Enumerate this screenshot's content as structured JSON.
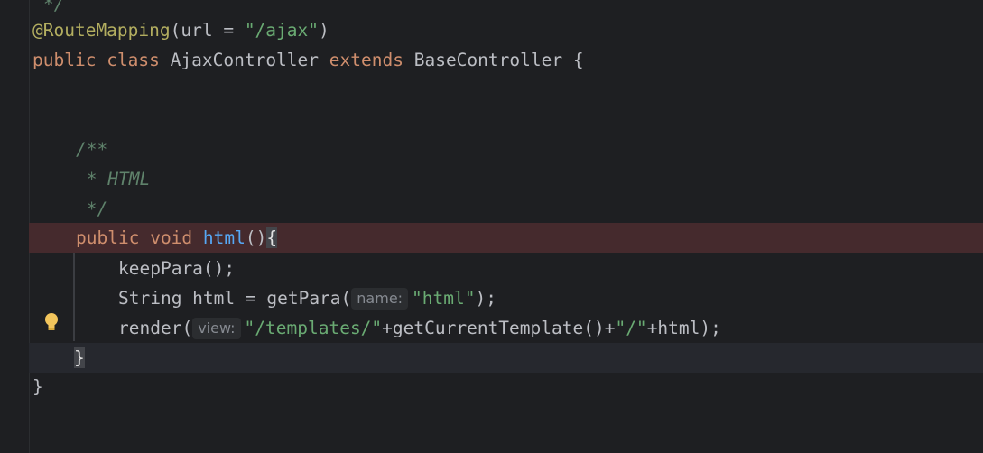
{
  "code": {
    "l0": "*/",
    "l1_ann": "@RouteMapping",
    "l1_rest": "(url = ",
    "l1_str": "\"/ajax\"",
    "l1_end": ")",
    "l2_kw1": "public",
    "l2_kw2": "class",
    "l2_name": "AjaxController",
    "l2_kw3": "extends",
    "l2_base": "BaseController {",
    "l5": "/**",
    "l6": " * HTML",
    "l7": " */",
    "l8_kw1": "public",
    "l8_kw2": "void",
    "l8_fn": "html",
    "l8_paren": "()",
    "l8_brace": "{",
    "l9": "keepPara();",
    "l10_pre": "String html = getPara(",
    "l10_hint": "name:",
    "l10_str": "\"html\"",
    "l10_end": ");",
    "l11_pre": "render(",
    "l11_hint": "view:",
    "l11_str1": "\"/templates/\"",
    "l11_mid": "+getCurrentTemplate()+",
    "l11_str2": "\"/\"",
    "l11_end": "+html);",
    "l12": "}",
    "l13": "}"
  },
  "icons": {
    "intention": "lightbulb-icon"
  },
  "colors": {
    "background": "#1e1f22",
    "keyword": "#cf8e6d",
    "annotation": "#b3ae60",
    "string": "#6aab73",
    "doc_comment": "#5f826b",
    "function": "#56a8f5",
    "breakpoint_line": "#452a2d"
  }
}
